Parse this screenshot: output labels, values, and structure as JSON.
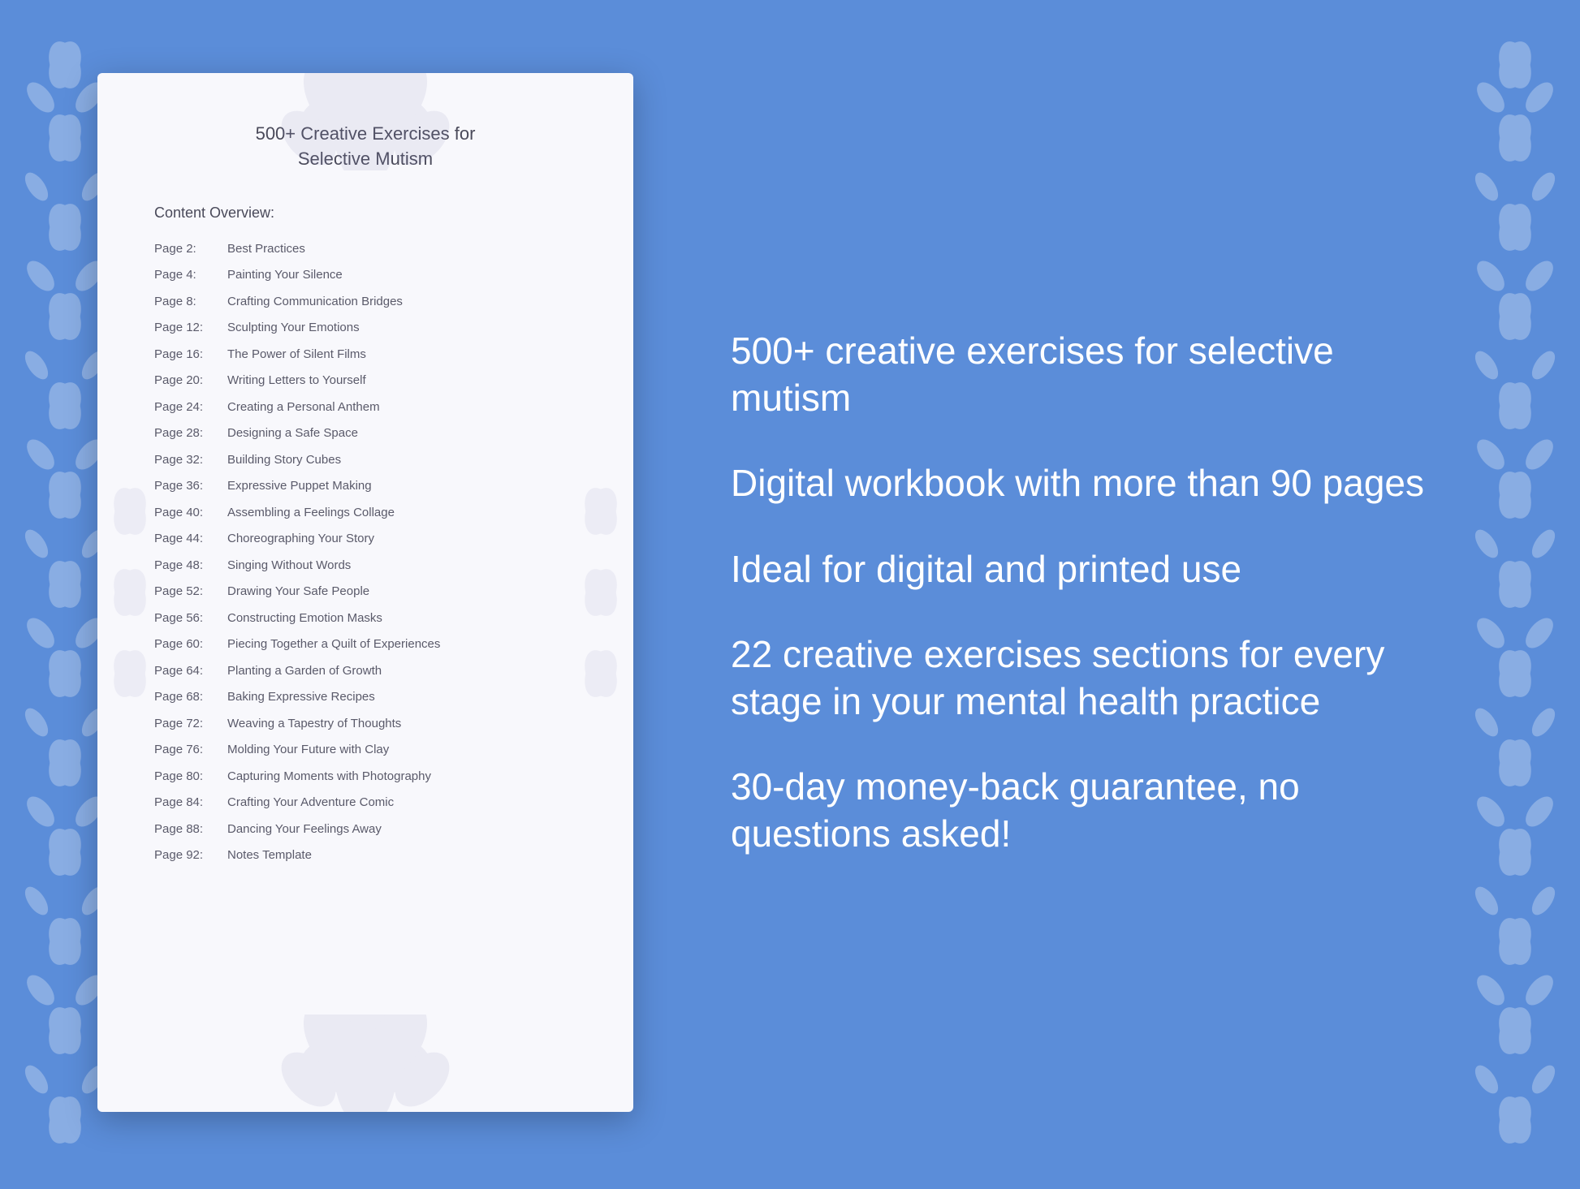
{
  "page": {
    "background_color": "#5b8dd9",
    "document": {
      "title_line1": "500+ Creative Exercises for",
      "title_line2": "Selective Mutism",
      "content_label": "Content Overview:",
      "toc_entries": [
        {
          "page": "Page  2:",
          "title": "Best Practices"
        },
        {
          "page": "Page  4:",
          "title": "Painting Your Silence"
        },
        {
          "page": "Page  8:",
          "title": "Crafting Communication Bridges"
        },
        {
          "page": "Page 12:",
          "title": "Sculpting Your Emotions"
        },
        {
          "page": "Page 16:",
          "title": "The Power of Silent Films"
        },
        {
          "page": "Page 20:",
          "title": "Writing Letters to Yourself"
        },
        {
          "page": "Page 24:",
          "title": "Creating a Personal Anthem"
        },
        {
          "page": "Page 28:",
          "title": "Designing a Safe Space"
        },
        {
          "page": "Page 32:",
          "title": "Building Story Cubes"
        },
        {
          "page": "Page 36:",
          "title": "Expressive Puppet Making"
        },
        {
          "page": "Page 40:",
          "title": "Assembling a Feelings Collage"
        },
        {
          "page": "Page 44:",
          "title": "Choreographing Your Story"
        },
        {
          "page": "Page 48:",
          "title": "Singing Without Words"
        },
        {
          "page": "Page 52:",
          "title": "Drawing Your Safe People"
        },
        {
          "page": "Page 56:",
          "title": "Constructing Emotion Masks"
        },
        {
          "page": "Page 60:",
          "title": "Piecing Together a Quilt of Experiences"
        },
        {
          "page": "Page 64:",
          "title": "Planting a Garden of Growth"
        },
        {
          "page": "Page 68:",
          "title": "Baking Expressive Recipes"
        },
        {
          "page": "Page 72:",
          "title": "Weaving a Tapestry of Thoughts"
        },
        {
          "page": "Page 76:",
          "title": "Molding Your Future with Clay"
        },
        {
          "page": "Page 80:",
          "title": "Capturing Moments with Photography"
        },
        {
          "page": "Page 84:",
          "title": "Crafting Your Adventure Comic"
        },
        {
          "page": "Page 88:",
          "title": "Dancing Your Feelings Away"
        },
        {
          "page": "Page 92:",
          "title": "Notes Template"
        }
      ]
    },
    "features": [
      "500+ creative exercises\nfor selective mutism",
      "Digital workbook with\nmore than 90 pages",
      "Ideal for digital and\nprinted use",
      "22 creative exercises\nsections for every stage\nin your mental health\npractice",
      "30-day money-back\nguarantee, no\nquestions asked!"
    ]
  }
}
